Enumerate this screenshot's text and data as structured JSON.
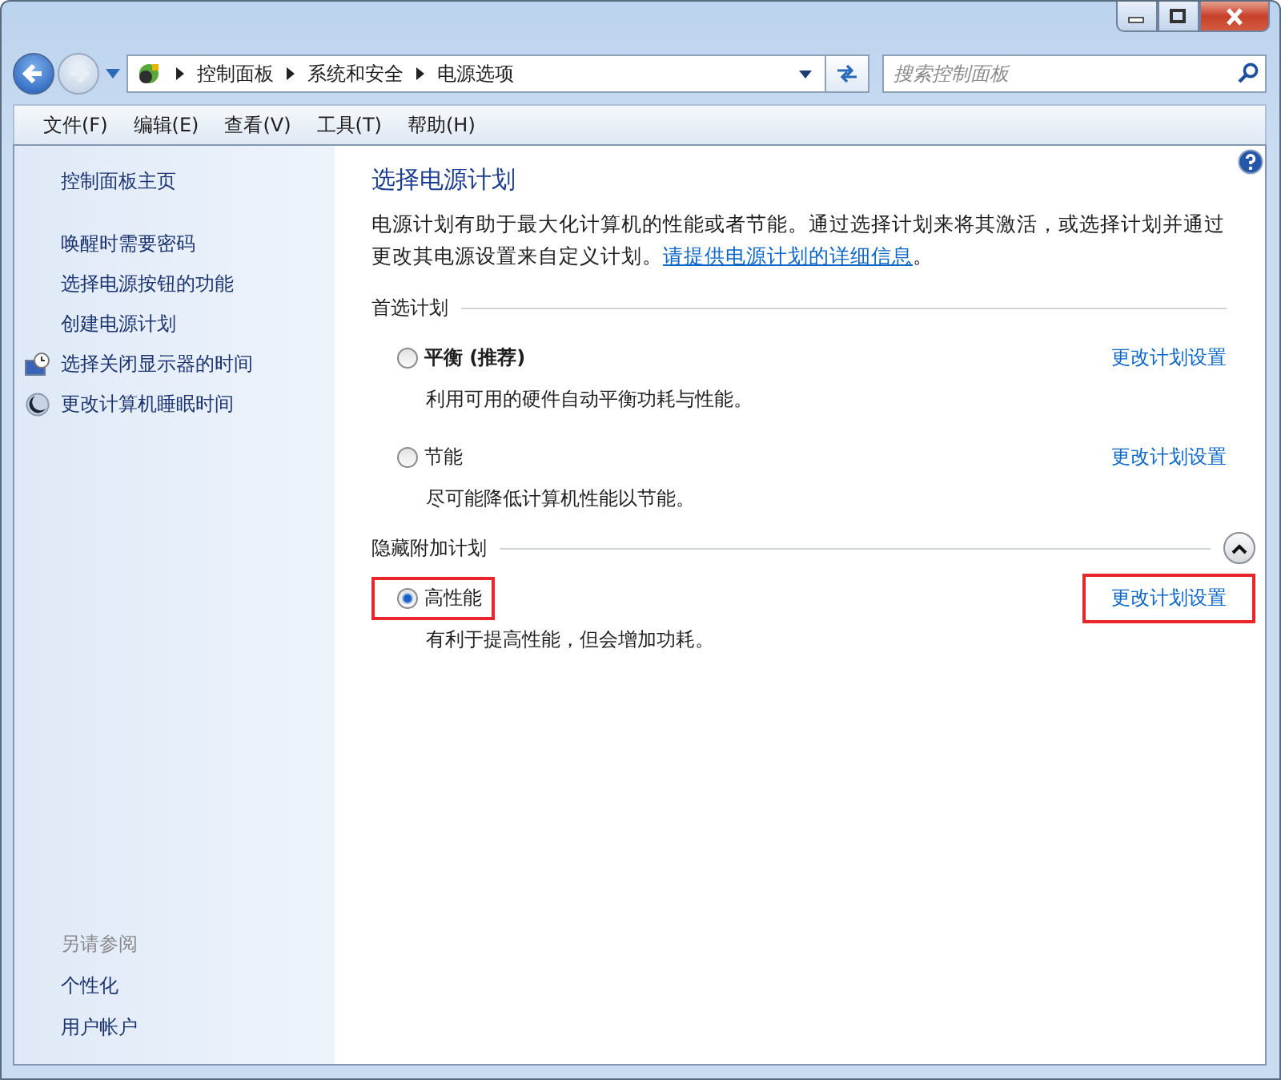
{
  "address": {
    "crumbs": [
      "控制面板",
      "系统和安全",
      "电源选项"
    ],
    "search_placeholder": "搜索控制面板"
  },
  "menu": [
    "文件(F)",
    "编辑(E)",
    "查看(V)",
    "工具(T)",
    "帮助(H)"
  ],
  "sidebar": {
    "home": "控制面板主页",
    "links": [
      "唤醒时需要密码",
      "选择电源按钮的功能",
      "创建电源计划",
      "选择关闭显示器的时间",
      "更改计算机睡眠时间"
    ],
    "see_also_title": "另请参阅",
    "see_also": [
      "个性化",
      "用户帐户"
    ]
  },
  "main": {
    "title": "选择电源计划",
    "description": "电源计划有助于最大化计算机的性能或者节能。通过选择计划来将其激活，或选择计划并通过更改其电源设置来自定义计划。",
    "description_link": "请提供电源计划的详细信息",
    "description_end": "。",
    "groups": [
      {
        "title": "首选计划",
        "plans": [
          {
            "name": "平衡 (推荐)",
            "recommended": true,
            "description": "利用可用的硬件自动平衡功耗与性能。",
            "selected": false,
            "link": "更改计划设置",
            "highlighted": false
          },
          {
            "name": "节能",
            "recommended": false,
            "description": "尽可能降低计算机性能以节能。",
            "selected": false,
            "link": "更改计划设置",
            "highlighted": false
          }
        ]
      },
      {
        "title": "隐藏附加计划",
        "toggle": {
          "expanded": true
        },
        "plans": [
          {
            "name": "高性能",
            "recommended": false,
            "description": "有利于提高性能，但会增加功耗。",
            "selected": true,
            "link": "更改计划设置",
            "highlighted": true
          }
        ]
      }
    ]
  }
}
